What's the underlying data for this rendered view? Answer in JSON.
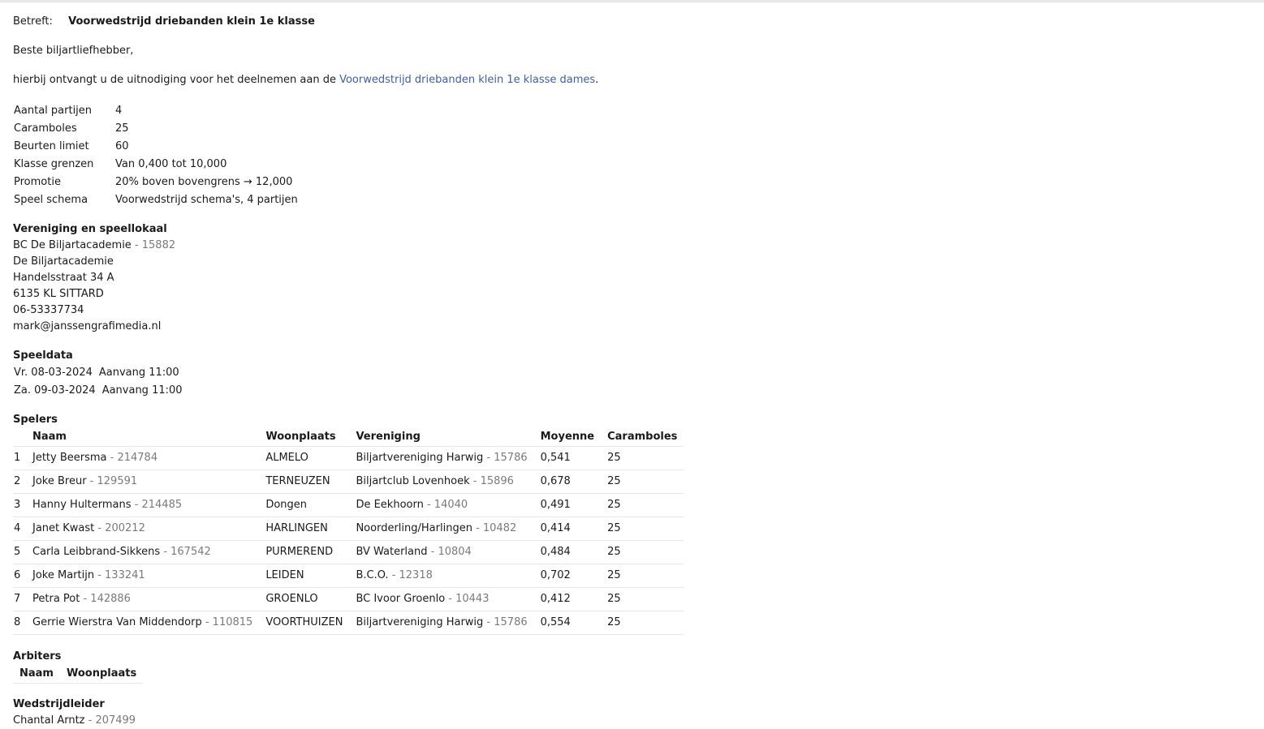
{
  "subject": {
    "label": "Betreft:",
    "value": "Voorwedstrijd driebanden klein 1e klasse"
  },
  "greeting": "Beste biljartliefhebber,",
  "intro": {
    "text": "hierbij ontvangt u de uitnodiging voor het deelnemen aan de ",
    "link": "Voorwedstrijd driebanden klein 1e klasse dames",
    "suffix": "."
  },
  "info": [
    {
      "key": "Aantal partijen",
      "value": "4"
    },
    {
      "key": "Caramboles",
      "value": "25"
    },
    {
      "key": "Beurten limiet",
      "value": "60"
    },
    {
      "key": "Klasse grenzen",
      "value": "Van 0,400 tot 10,000"
    },
    {
      "key": "Promotie",
      "value": "20% boven bovengrens → 12,000"
    },
    {
      "key": "Speel schema",
      "value": "Voorwedstrijd schema's, 4 partijen"
    }
  ],
  "venue": {
    "heading": "Vereniging en speellokaal",
    "club": "BC De Biljartacademie",
    "club_id": " - 15882",
    "name": "De Biljartacademie",
    "street": "Handelsstraat 34 A",
    "city": "6135 KL SITTARD",
    "phone": "06-53337734",
    "email": "mark@janssengrafimedia.nl"
  },
  "dates": {
    "heading": "Speeldata",
    "items": [
      {
        "date": "Vr. 08-03-2024",
        "start": "Aanvang 11:00"
      },
      {
        "date": "Za. 09-03-2024",
        "start": "Aanvang 11:00"
      }
    ]
  },
  "players": {
    "heading": "Spelers",
    "columns": [
      "Naam",
      "Woonplaats",
      "Vereniging",
      "Moyenne",
      "Caramboles"
    ],
    "rows": [
      {
        "nr": "1",
        "name": "Jetty Beersma",
        "id": " - 214784",
        "city": "ALMELO",
        "club": "Biljartvereniging Harwig",
        "club_id": " - 15786",
        "avg": "0,541",
        "car": "25"
      },
      {
        "nr": "2",
        "name": "Joke Breur",
        "id": " - 129591",
        "city": "TERNEUZEN",
        "club": "Biljartclub Lovenhoek",
        "club_id": " - 15896",
        "avg": "0,678",
        "car": "25"
      },
      {
        "nr": "3",
        "name": "Hanny Hultermans",
        "id": " - 214485",
        "city": "Dongen",
        "club": "De Eekhoorn",
        "club_id": " - 14040",
        "avg": "0,491",
        "car": "25"
      },
      {
        "nr": "4",
        "name": "Janet Kwast",
        "id": " - 200212",
        "city": "HARLINGEN",
        "club": "Noorderling/Harlingen",
        "club_id": " - 10482",
        "avg": "0,414",
        "car": "25"
      },
      {
        "nr": "5",
        "name": "Carla Leibbrand-Sikkens",
        "id": " - 167542",
        "city": "PURMEREND",
        "club": "BV Waterland",
        "club_id": " - 10804",
        "avg": "0,484",
        "car": "25"
      },
      {
        "nr": "6",
        "name": "Joke Martijn",
        "id": " - 133241",
        "city": "LEIDEN",
        "club": "B.C.O.",
        "club_id": " - 12318",
        "avg": "0,702",
        "car": "25"
      },
      {
        "nr": "7",
        "name": "Petra Pot",
        "id": " - 142886",
        "city": "GROENLO",
        "club": "BC Ivoor Groenlo",
        "club_id": " - 10443",
        "avg": "0,412",
        "car": "25"
      },
      {
        "nr": "8",
        "name": "Gerrie Wierstra Van Middendorp",
        "id": " - 110815",
        "city": "VOORTHUIZEN",
        "club": "Biljartvereniging Harwig",
        "club_id": " - 15786",
        "avg": "0,554",
        "car": "25"
      }
    ]
  },
  "arbiters": {
    "heading": "Arbiters",
    "columns": [
      "Naam",
      "Woonplaats"
    ]
  },
  "director": {
    "heading": "Wedstrijdleider",
    "name": "Chantal Arntz",
    "id": " - 207499"
  }
}
